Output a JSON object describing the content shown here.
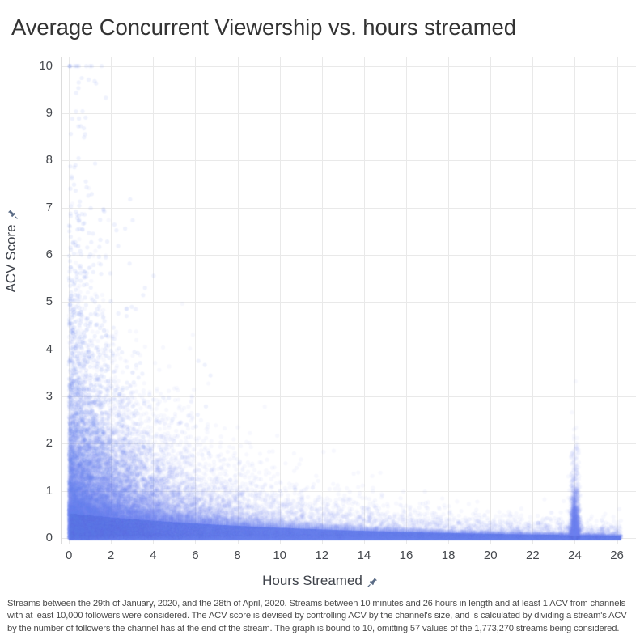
{
  "title": "Average Concurrent Viewership vs. hours streamed",
  "footnote": "Streams between the 29th of January, 2020, and the 28th of April, 2020. Streams between 10 minutes and 26 hours in length and at least 1 ACV from channels with at least 10,000 followers were considered.  The ACV score is devised by controlling ACV by the channel's size, and is calculated by dividing a stream's ACV by the number of followers the channel has at the end of the stream. The graph is bound to 10, omitting 57 values of the 1,773,270 streams being considered.",
  "axes": {
    "x_title": "Hours Streamed",
    "y_title": "ACV Score",
    "x_icon": "pushpin-icon",
    "y_icon": "pushpin-icon"
  },
  "colors": {
    "point": "#6680f0",
    "point_dense": "#6a84ef",
    "grid": "#e9e9e9",
    "title_text": "#333333",
    "tick_text": "#45484d",
    "axis_title_text": "#3e424a",
    "footnote_text": "#4a4a4a",
    "icon": "#5a6b85",
    "background": "#ffffff"
  },
  "chart_data": {
    "type": "scatter",
    "title": "Average Concurrent Viewership vs. hours streamed",
    "xlabel": "Hours Streamed",
    "ylabel": "ACV Score",
    "xlim": [
      -0.35,
      26.9
    ],
    "ylim": [
      -0.12,
      10.2
    ],
    "xticks": [
      0,
      2,
      4,
      6,
      8,
      10,
      12,
      14,
      16,
      18,
      20,
      22,
      24,
      26
    ],
    "yticks": [
      0,
      1,
      2,
      3,
      4,
      5,
      6,
      7,
      8,
      9,
      10
    ],
    "xtick_labels": [
      "0",
      "2",
      "4",
      "6",
      "8",
      "10",
      "12",
      "14",
      "16",
      "18",
      "20",
      "22",
      "24",
      "26"
    ],
    "ytick_labels": [
      "0",
      "1",
      "2",
      "3",
      "4",
      "5",
      "6",
      "7",
      "8",
      "9",
      "10"
    ],
    "grid": true,
    "legend": false,
    "n_points_total": 1773270,
    "n_points_omitted": 57,
    "marker": {
      "shape": "circle",
      "radius_px": 2.6,
      "color": "#6680f0",
      "opacity": 0.055
    },
    "description": "Dense exponential-decay cloud: ACV score falls off sharply as hours streamed increases; highest density hugs x<2 and y<1, with a saturated solid band along y=0 and a distinct vertical concentration spike at x=24 hours.",
    "density_model": {
      "n_rendered": 26000,
      "x_distribution": "mixture: 72% exponential(scale 3.1) clipped to [0,26.2], 22% uniform(0,26.2), 6% normal(mu=24.0, sigma=0.11)",
      "y_distribution": "exponential with x-dependent scale: scale(x) = 0.92 * exp(-0.118 * x) + 0.055, clipped to [0,10]",
      "baseline_band": {
        "note": "near-solid saturated fill from y=0 up to y_top(x)",
        "y_top_at_x0": 1.02,
        "y_top_at_x26": 0.1,
        "decay": "exponential"
      },
      "spike_at_x24": {
        "x": 24.0,
        "sigma_x": 0.11,
        "y_scale": 0.62,
        "fraction": 0.06
      }
    },
    "sample_density_profile": [
      {
        "x": 0.5,
        "median_y": 0.42,
        "p90_y": 2.45,
        "max_y": 10.0
      },
      {
        "x": 1.0,
        "median_y": 0.38,
        "p90_y": 2.1,
        "max_y": 9.7
      },
      {
        "x": 2.0,
        "median_y": 0.31,
        "p90_y": 1.62,
        "max_y": 9.3
      },
      {
        "x": 3.0,
        "median_y": 0.26,
        "p90_y": 1.3,
        "max_y": 8.2
      },
      {
        "x": 4.0,
        "median_y": 0.22,
        "p90_y": 1.1,
        "max_y": 7.6
      },
      {
        "x": 6.0,
        "median_y": 0.17,
        "p90_y": 0.82,
        "max_y": 6.1
      },
      {
        "x": 8.0,
        "median_y": 0.13,
        "p90_y": 0.64,
        "max_y": 4.8
      },
      {
        "x": 10.0,
        "median_y": 0.11,
        "p90_y": 0.52,
        "max_y": 3.9
      },
      {
        "x": 12.0,
        "median_y": 0.09,
        "p90_y": 0.44,
        "max_y": 3.3
      },
      {
        "x": 14.0,
        "median_y": 0.08,
        "p90_y": 0.38,
        "max_y": 2.6
      },
      {
        "x": 16.0,
        "median_y": 0.07,
        "p90_y": 0.33,
        "max_y": 2.1
      },
      {
        "x": 18.0,
        "median_y": 0.06,
        "p90_y": 0.29,
        "max_y": 1.7
      },
      {
        "x": 20.0,
        "median_y": 0.05,
        "p90_y": 0.25,
        "max_y": 1.4
      },
      {
        "x": 22.0,
        "median_y": 0.05,
        "p90_y": 0.22,
        "max_y": 1.2
      },
      {
        "x": 24.0,
        "median_y": 0.05,
        "p90_y": 0.3,
        "max_y": 1.5
      },
      {
        "x": 26.0,
        "median_y": 0.04,
        "p90_y": 0.18,
        "max_y": 0.9
      }
    ]
  }
}
